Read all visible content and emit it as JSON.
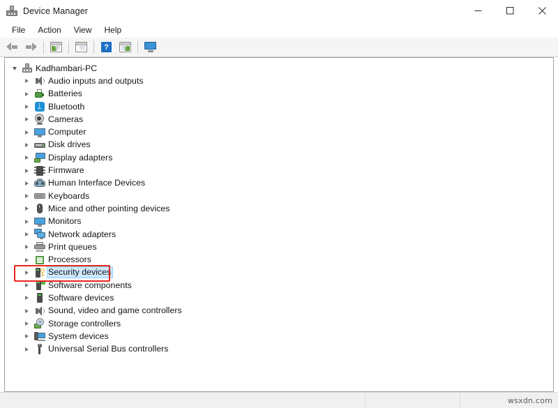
{
  "window": {
    "title": "Device Manager",
    "app_icon": "device-manager-icon",
    "controls": {
      "minimize": "minimize",
      "maximize": "maximize",
      "close": "close"
    }
  },
  "menubar": {
    "items": [
      {
        "label": "File"
      },
      {
        "label": "Action"
      },
      {
        "label": "View"
      },
      {
        "label": "Help"
      }
    ]
  },
  "toolbar": {
    "buttons": [
      {
        "name": "back-arrow-icon",
        "type": "arrow-left"
      },
      {
        "name": "forward-arrow-icon",
        "type": "arrow-right"
      },
      {
        "name": "show-hide-console-tree-icon",
        "type": "window-green"
      },
      {
        "name": "properties-icon",
        "type": "window-plain"
      },
      {
        "name": "help-icon",
        "type": "help",
        "glyph": "?"
      },
      {
        "name": "update-driver-icon",
        "type": "window-play"
      },
      {
        "name": "scan-for-hardware-changes-icon",
        "type": "monitor"
      }
    ]
  },
  "tree": {
    "root": {
      "label": "Kadhambari-PC",
      "icon": "computer-icon",
      "expanded": true,
      "chevron": "chevron-down"
    },
    "items": [
      {
        "label": "Audio inputs and outputs",
        "icon": "speaker-icon",
        "chevron": "chevron-right",
        "selected": false
      },
      {
        "label": "Batteries",
        "icon": "battery-icon",
        "chevron": "chevron-right",
        "selected": false
      },
      {
        "label": "Bluetooth",
        "icon": "bluetooth-icon",
        "chevron": "chevron-right",
        "selected": false
      },
      {
        "label": "Cameras",
        "icon": "camera-icon",
        "chevron": "chevron-right",
        "selected": false
      },
      {
        "label": "Computer",
        "icon": "monitor-icon",
        "chevron": "chevron-right",
        "selected": false
      },
      {
        "label": "Disk drives",
        "icon": "disk-drive-icon",
        "chevron": "chevron-right",
        "selected": false
      },
      {
        "label": "Display adapters",
        "icon": "display-adapter-icon",
        "chevron": "chevron-right",
        "selected": false
      },
      {
        "label": "Firmware",
        "icon": "chip-icon",
        "chevron": "chevron-right",
        "selected": false
      },
      {
        "label": "Human Interface Devices",
        "icon": "gamepad-icon",
        "chevron": "chevron-right",
        "selected": false
      },
      {
        "label": "Keyboards",
        "icon": "keyboard-icon",
        "chevron": "chevron-right",
        "selected": false
      },
      {
        "label": "Mice and other pointing devices",
        "icon": "mouse-icon",
        "chevron": "chevron-right",
        "selected": false
      },
      {
        "label": "Monitors",
        "icon": "monitor-icon",
        "chevron": "chevron-right",
        "selected": false
      },
      {
        "label": "Network adapters",
        "icon": "network-adapter-icon",
        "chevron": "chevron-right",
        "selected": false
      },
      {
        "label": "Print queues",
        "icon": "printer-icon",
        "chevron": "chevron-right",
        "selected": false
      },
      {
        "label": "Processors",
        "icon": "processor-icon",
        "chevron": "chevron-right",
        "selected": false
      },
      {
        "label": "Security devices",
        "icon": "security-device-icon",
        "chevron": "chevron-right",
        "selected": true
      },
      {
        "label": "Software components",
        "icon": "software-component-icon",
        "chevron": "chevron-right",
        "selected": false
      },
      {
        "label": "Software devices",
        "icon": "software-device-icon",
        "chevron": "chevron-right",
        "selected": false
      },
      {
        "label": "Sound, video and game controllers",
        "icon": "speaker-icon",
        "chevron": "chevron-right",
        "selected": false
      },
      {
        "label": "Storage controllers",
        "icon": "storage-controller-icon",
        "chevron": "chevron-right",
        "selected": false
      },
      {
        "label": "System devices",
        "icon": "system-device-icon",
        "chevron": "chevron-right",
        "selected": false
      },
      {
        "label": "Universal Serial Bus controllers",
        "icon": "usb-icon",
        "chevron": "chevron-right",
        "selected": false
      }
    ]
  },
  "annotation": {
    "target_label": "Security devices",
    "color": "#e8241c",
    "shape": "rectangle"
  },
  "statusbar": {
    "watermark": "wsxdn.com"
  },
  "colors": {
    "selection_fill": "#cce8ff",
    "selection_border": "#99d1ff",
    "annotation_red": "#e8241c",
    "toolbar_bg": "#f5f5f5",
    "statusbar_bg": "#f0f0f0"
  }
}
